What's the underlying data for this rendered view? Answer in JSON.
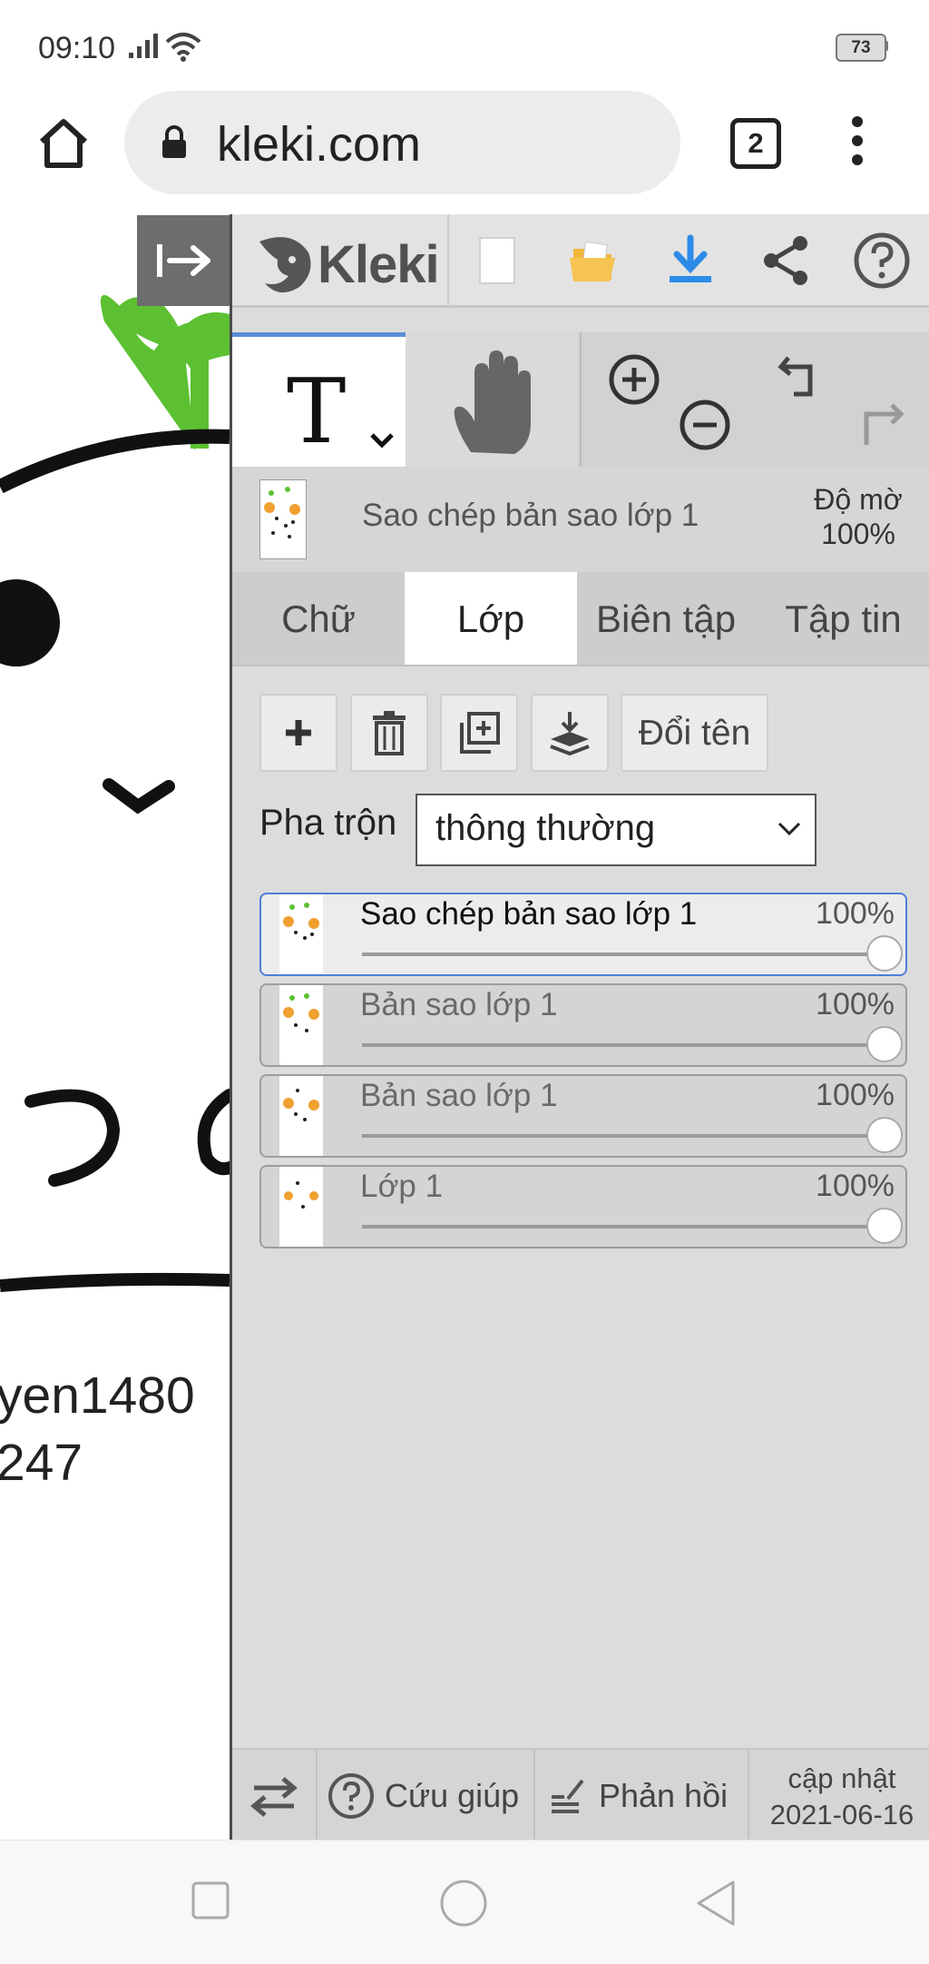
{
  "status": {
    "time": "09:10",
    "battery": "73"
  },
  "browser": {
    "url": "kleki.com",
    "tab_count": "2"
  },
  "canvas": {
    "text_line1": "yen1480",
    "text_line2": "247"
  },
  "app": {
    "name": "Kleki",
    "accent": "#2c8be8",
    "folder_color": "#f1b63c"
  },
  "current_layer": {
    "name": "Sao chép bản sao lớp 1",
    "opacity_label": "Độ mờ",
    "opacity_value": "100%"
  },
  "tabs": [
    {
      "label": "Chữ"
    },
    {
      "label": "Lớp"
    },
    {
      "label": "Biên tập"
    },
    {
      "label": "Tập tin"
    }
  ],
  "layer_panel": {
    "rename_label": "Đổi tên",
    "blend_label": "Pha trộn",
    "blend_value": "thông thường",
    "layers": [
      {
        "name": "Sao chép bản sao lớp 1",
        "opacity": "100%"
      },
      {
        "name": "Bản sao lớp 1",
        "opacity": "100%"
      },
      {
        "name": "Bản sao lớp 1",
        "opacity": "100%"
      },
      {
        "name": "Lớp 1",
        "opacity": "100%"
      }
    ]
  },
  "footer": {
    "help_label": "Cứu giúp",
    "feedback_label": "Phản hồi",
    "update_label": "cập nhật",
    "update_date": "2021-06-16"
  }
}
